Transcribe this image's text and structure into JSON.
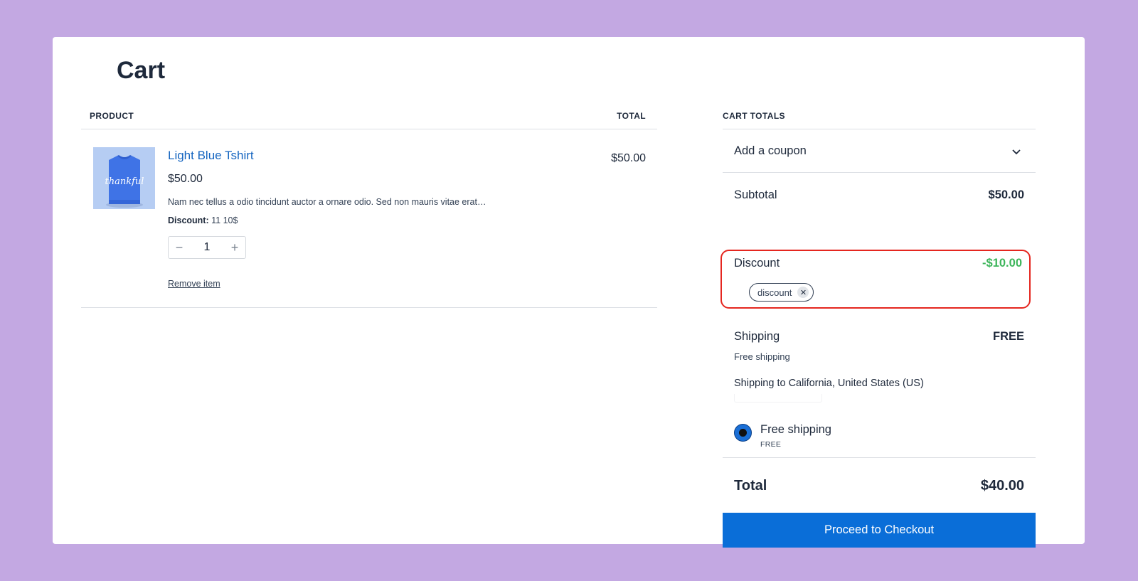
{
  "page": {
    "title": "Cart"
  },
  "products": {
    "header_product": "PRODUCT",
    "header_total": "TOTAL",
    "items": [
      {
        "name": "Light Blue Tshirt",
        "price": "$50.00",
        "description": "Nam nec tellus a odio tincidunt auctor a ornare odio. Sed non mauris vitae erat…",
        "discount_label": "Discount:",
        "discount_value": "11 10$",
        "quantity": "1",
        "remove_label": "Remove item",
        "line_total": "$50.00",
        "thumb_text": "thankful",
        "thumb_icon": "tshirt-image"
      }
    ]
  },
  "totals": {
    "header": "CART TOTALS",
    "coupon_label": "Add a coupon",
    "subtotal_label": "Subtotal",
    "subtotal_value": "$50.00",
    "discount_label": "Discount",
    "discount_value": "-$10.00",
    "discount_chip": "discount",
    "shipping_label": "Shipping",
    "shipping_value": "FREE",
    "shipping_method": "Free shipping",
    "shipping_destination": "Shipping to California, United States (US)",
    "shipping_option_name": "Free shipping",
    "shipping_option_price": "FREE",
    "total_label": "Total",
    "total_value": "$40.00",
    "checkout_label": "Proceed to Checkout"
  },
  "colors": {
    "background": "#c3a8e2",
    "accent": "#0a6ed8",
    "link": "#1565c0",
    "discount_green": "#3cb55a",
    "highlight_red": "#e5261f"
  }
}
